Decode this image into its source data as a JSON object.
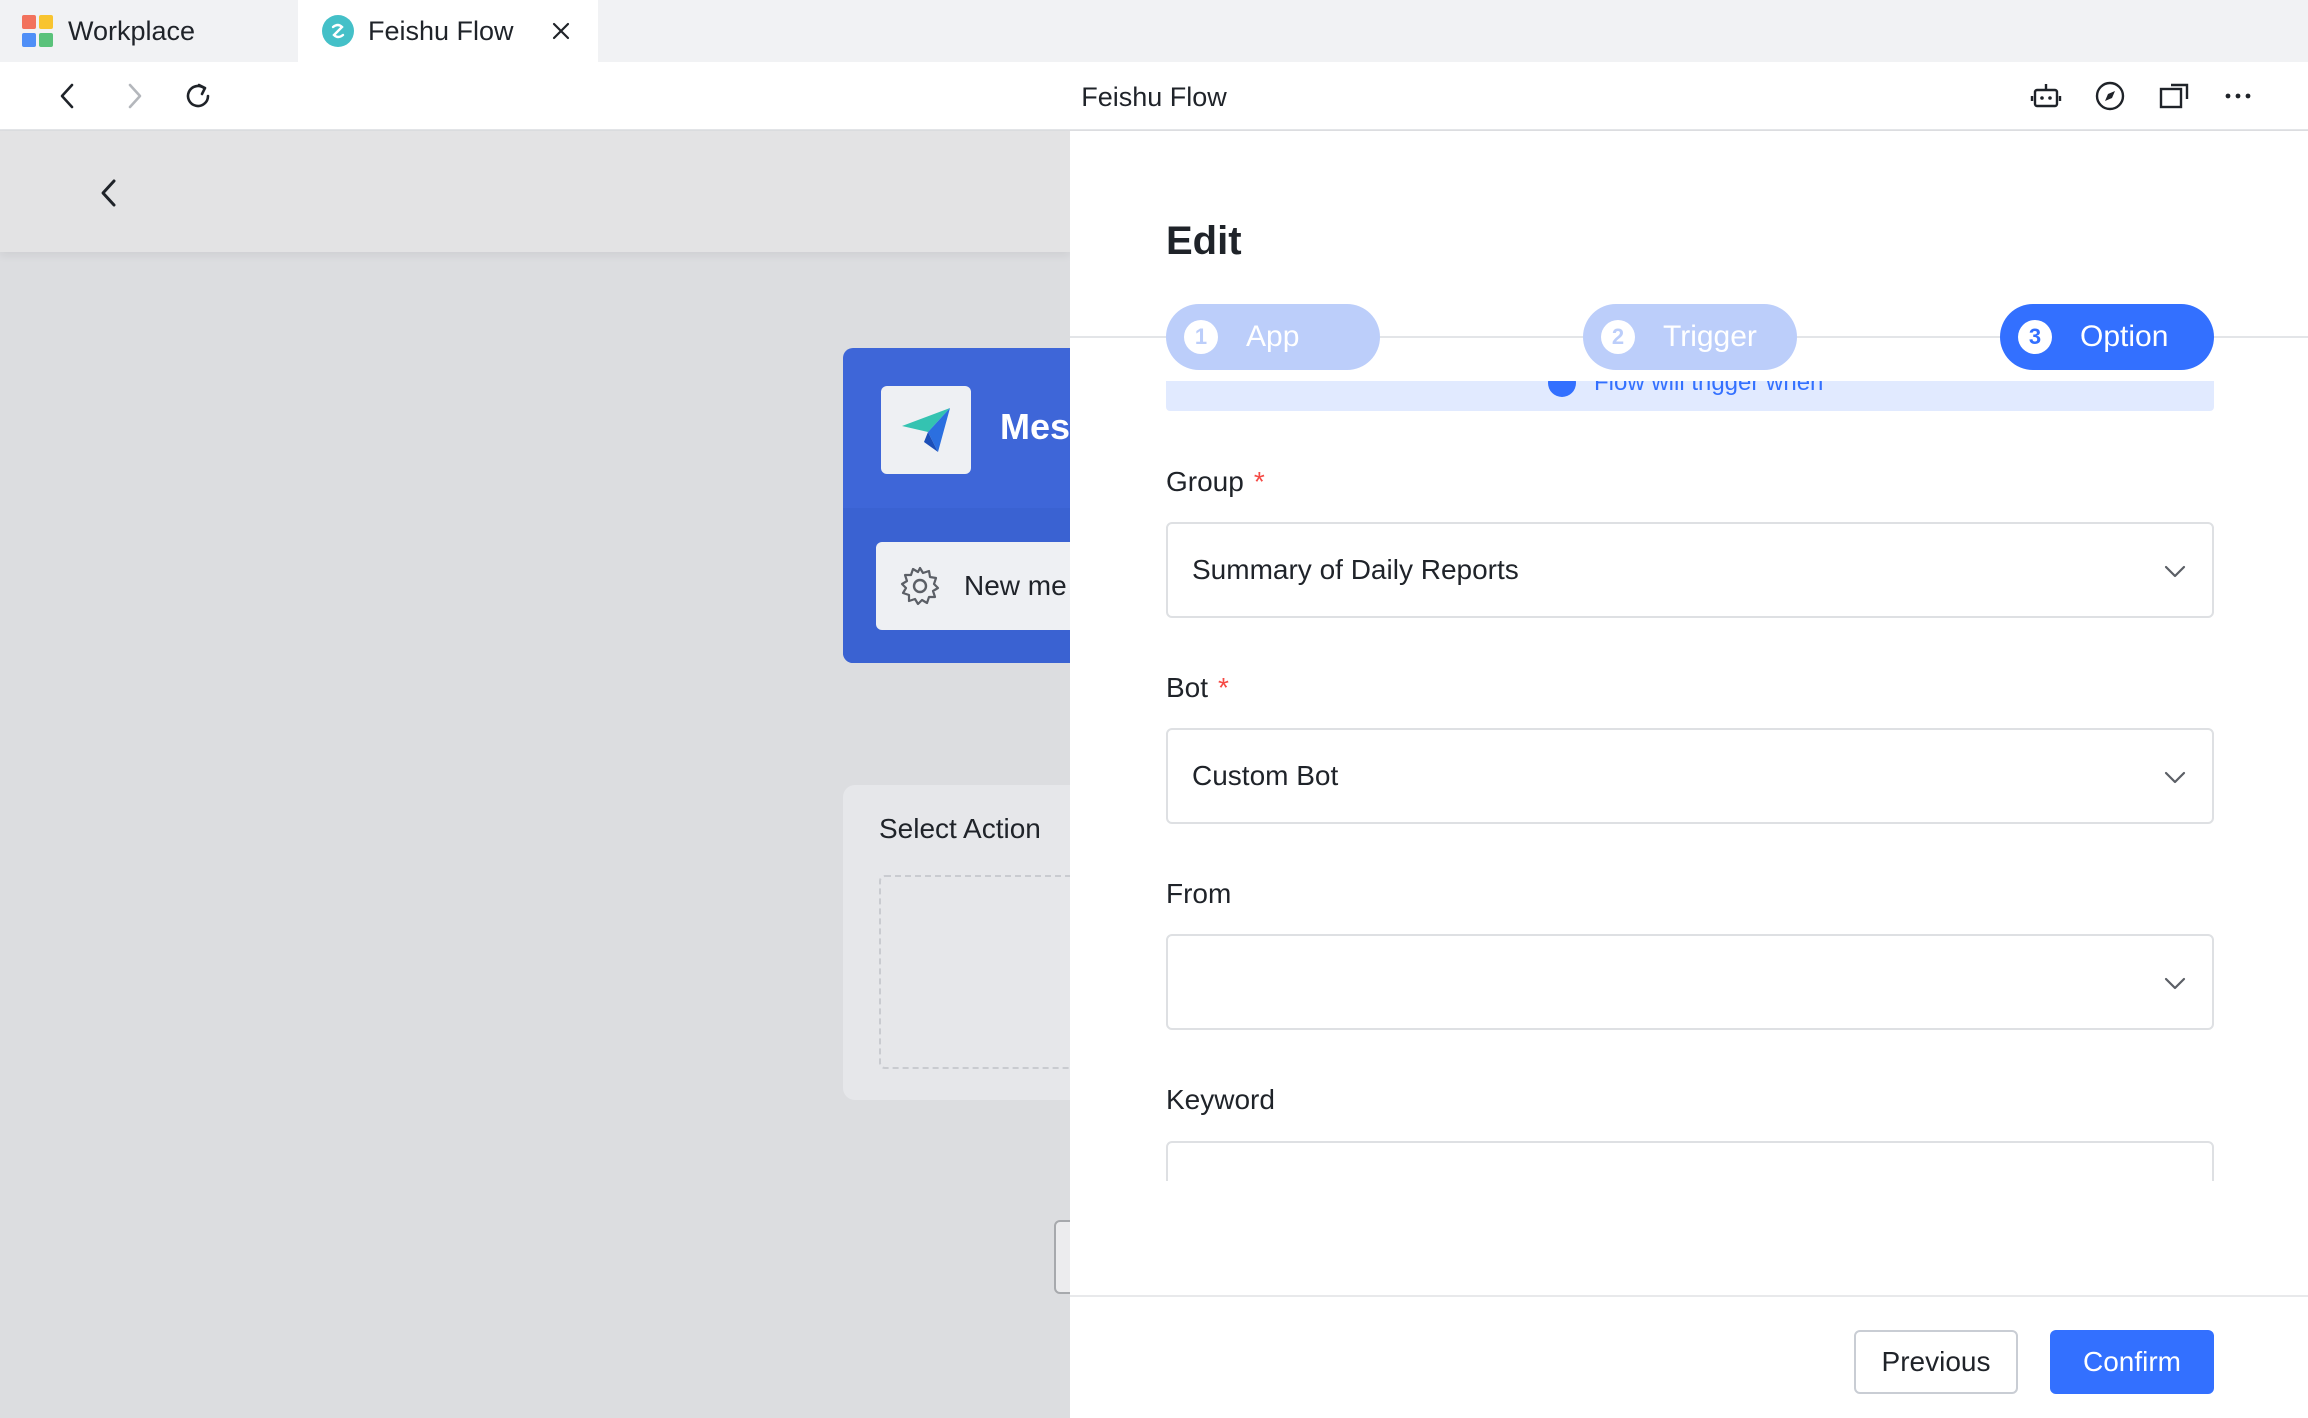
{
  "browser": {
    "tabs": [
      {
        "label": "Workplace",
        "icon": "workplace-grid-icon"
      },
      {
        "label": "Feishu Flow",
        "icon": "feishu-flow-icon",
        "active": true
      }
    ],
    "page_title": "Feishu Flow"
  },
  "background": {
    "trigger_app_name": "Mess",
    "trigger_event": "New me",
    "action_title": "Select Action"
  },
  "drawer": {
    "title": "Edit",
    "steps": [
      {
        "num": "1",
        "label": "App",
        "state": "inactive"
      },
      {
        "num": "2",
        "label": "Trigger",
        "state": "inactive"
      },
      {
        "num": "3",
        "label": "Option",
        "state": "active"
      }
    ],
    "notice": "Flow will trigger when",
    "fields": {
      "group": {
        "label": "Group",
        "required": "*",
        "value": "Summary of Daily Reports"
      },
      "bot": {
        "label": "Bot",
        "required": "*",
        "value": "Custom Bot"
      },
      "from": {
        "label": "From",
        "value": ""
      },
      "keyword": {
        "label": "Keyword",
        "value": ""
      }
    },
    "buttons": {
      "previous": "Previous",
      "confirm": "Confirm"
    }
  },
  "colors": {
    "accent": "#3370ff",
    "accent_light": "#bccefa",
    "required": "#f54a45",
    "trigger_card": "#3e66d8"
  }
}
